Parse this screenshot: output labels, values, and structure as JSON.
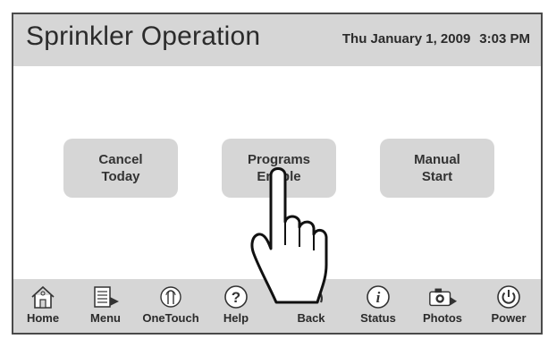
{
  "header": {
    "title": "Sprinkler Operation",
    "date": "Thu January 1, 2009",
    "time": "3:03 PM"
  },
  "buttons": [
    {
      "line1": "Cancel",
      "line2": "Today"
    },
    {
      "line1": "Programs",
      "line2": "Enable"
    },
    {
      "line1": "Manual",
      "line2": "Start"
    }
  ],
  "nav": [
    {
      "label": "Home",
      "icon": "home-icon"
    },
    {
      "label": "Menu",
      "icon": "menu-icon"
    },
    {
      "label": "OneTouch",
      "icon": "onetouch-icon"
    },
    {
      "label": "Help",
      "icon": "help-icon"
    },
    {
      "label": "Back",
      "icon": "back-icon"
    },
    {
      "label": "Status",
      "icon": "status-icon"
    },
    {
      "label": "Photos",
      "icon": "camera-icon"
    },
    {
      "label": "Power",
      "icon": "power-icon"
    }
  ],
  "colors": {
    "panel": "#d6d6d6",
    "border": "#4a4a4a",
    "text": "#2b2b2b"
  }
}
